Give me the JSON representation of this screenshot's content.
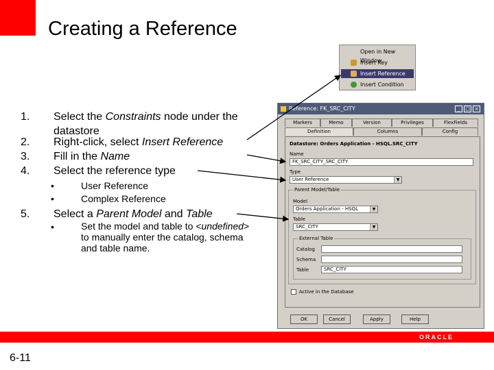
{
  "slide": {
    "title": "Creating a Reference",
    "page_number": "6-11",
    "brand": "ORACLE",
    "colors": {
      "accent": "#ff0000",
      "title_bar": "#4e5b78",
      "dialog_bg": "#d4d0c8",
      "menu_selected": "#3a3a6a"
    }
  },
  "steps": [
    {
      "num": "1.",
      "text_html": "Select the <i>Constraints</i> node under the datastore"
    },
    {
      "num": "2.",
      "text_html": "Right-click, select <i>Insert Reference</i>"
    },
    {
      "num": "3.",
      "text_html": "Fill in the <i>Name</i>"
    },
    {
      "num": "4.",
      "text_html": "Select the reference type"
    },
    {
      "num": "5.",
      "text_html": "Select a <i>Parent Model</i> and <i>Table</i>"
    }
  ],
  "step4_subs": [
    "User Reference",
    "Complex Reference"
  ],
  "step5_sub_html": "Set the model and table to &lt;<i>undefined</i>&gt; to manually enter the catalog, schema and table name.",
  "bullet_char": "•",
  "context_menu": {
    "items": [
      {
        "label": "Open in New Window",
        "icon": "",
        "selected": false
      },
      {
        "label": "Insert Key",
        "icon": "key-icon",
        "selected": false
      },
      {
        "label": "Insert Reference",
        "icon": "reference-icon",
        "selected": true
      },
      {
        "label": "Insert Condition",
        "icon": "condition-icon",
        "selected": false
      }
    ]
  },
  "dialog": {
    "title": "Reference: FK_SRC_CITY",
    "tabs_back": [
      "Markers",
      "Memo",
      "Version",
      "Privileges",
      "FlexFields"
    ],
    "tabs_front": [
      "Definition",
      "Columns",
      "Config"
    ],
    "heading": "Datastore: Orders Application - HSQL.SRC_CITY",
    "name_label": "Name",
    "name_value": "FK_SRC_CITY_SRC_CITY",
    "type_label": "Type",
    "type_value": "User Reference",
    "parent_group": "Parent Model/Table",
    "model_label": "Model",
    "model_value": "Orders Application - HSQL",
    "table_label": "Table",
    "table_value": "SRC_CITY",
    "external_group": "External Table",
    "catalog_label": "Catalog",
    "catalog_value": "",
    "schema_label": "Schema",
    "schema_value": "",
    "ext_table_label": "Table",
    "ext_table_value": "SRC_CITY",
    "active_label": "Active in the Database",
    "buttons": [
      "OK",
      "Cancel",
      "Apply",
      "Help"
    ],
    "window_buttons": [
      "_",
      "□",
      "×"
    ]
  }
}
